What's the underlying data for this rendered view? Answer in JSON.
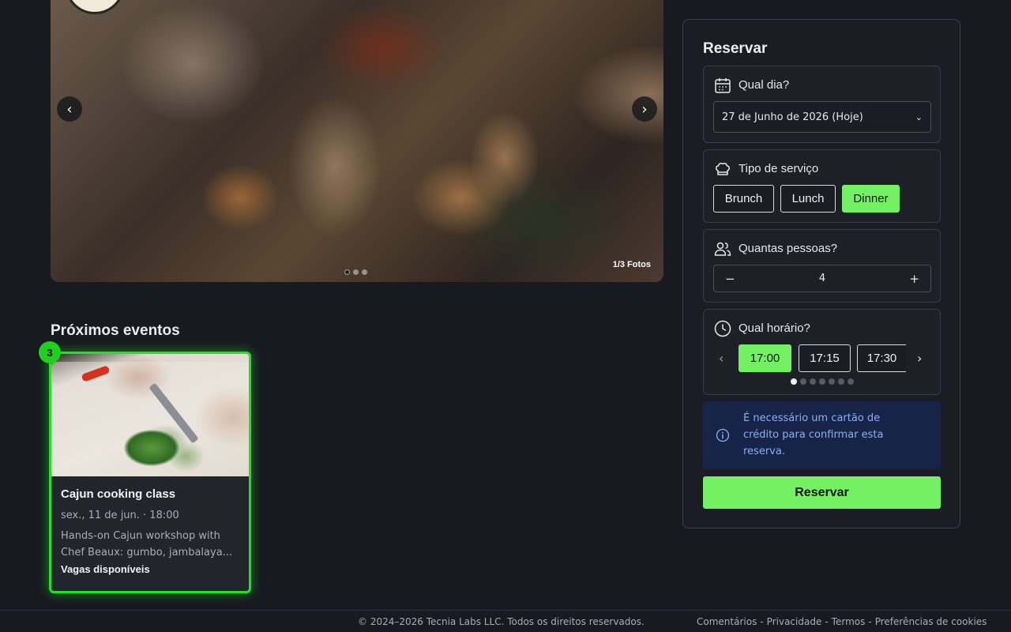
{
  "hero": {
    "photo_count": "1/3 Fotos",
    "prev_icon": "chevron-left-icon",
    "next_icon": "chevron-right-icon"
  },
  "events": {
    "title": "Próximos eventos",
    "badge_count": "3",
    "items": [
      {
        "name": "Cajun cooking class",
        "date": "sex., 11 de jun. · 18:00",
        "description": "Hands-on Cajun workshop with Chef Beaux: gumbo, jambalaya...",
        "status": "Vagas disponíveis"
      }
    ]
  },
  "reservation": {
    "title": "Reservar",
    "day": {
      "label": "Qual dia?",
      "icon": "calendar-icon",
      "selected": "27 de Junho de 2026 (Hoje)"
    },
    "service": {
      "label": "Tipo de serviço",
      "icon": "chef-hat-icon",
      "options": [
        "Brunch",
        "Lunch",
        "Dinner"
      ],
      "selected": "Dinner"
    },
    "people": {
      "label": "Quantas pessoas?",
      "icon": "users-icon",
      "value": "4",
      "minus": "−",
      "plus": "+"
    },
    "time": {
      "label": "Qual horário?",
      "icon": "clock-icon",
      "options": [
        "17:00",
        "17:15",
        "17:30"
      ],
      "selected": "17:00"
    },
    "info": {
      "icon": "info-icon",
      "text": "É necessário um cartão de crédito para confirmar esta reserva."
    },
    "submit_label": "Reservar"
  },
  "footer": {
    "copyright": "© 2024–2026 Tecnia Labs LLC. Todos os direitos reservados.",
    "links": [
      "Comentários",
      "Privacidade",
      "Termos",
      "Preferências de cookies"
    ]
  },
  "colors": {
    "background": "#171a20",
    "accent": "#74f163",
    "highlight": "#22e022",
    "info_bg": "#172447",
    "info_text": "#8aaef5"
  }
}
